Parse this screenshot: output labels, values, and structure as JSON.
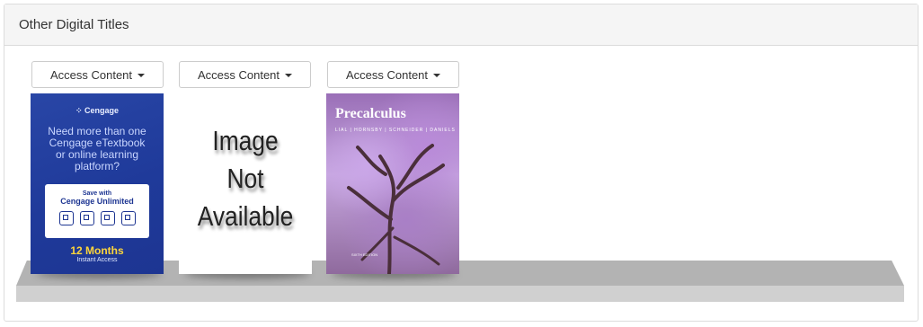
{
  "panel": {
    "title": "Other Digital Titles"
  },
  "books": [
    {
      "button_label": "Access Content",
      "cover": {
        "logo": "Cengage",
        "pitch": "Need more than one Cengage eTextbook or online learning platform?",
        "save": "Save with",
        "unlimited": "Cengage Unlimited",
        "months": "12 Months",
        "instant": "Instant Access"
      }
    },
    {
      "button_label": "Access Content",
      "cover": {
        "line1": "Image",
        "line2": "Not",
        "line3": "Available"
      }
    },
    {
      "button_label": "Access Content",
      "cover": {
        "title": "Precalculus",
        "authors": "LIAL | HORNSBY | SCHNEIDER | DANIELS",
        "edition": "SIXTH EDITION"
      }
    }
  ],
  "colors": {
    "cengage_blue": "#1f3a9a",
    "accent_yellow": "#ffd63a",
    "shelf": "#b3b3b3"
  }
}
